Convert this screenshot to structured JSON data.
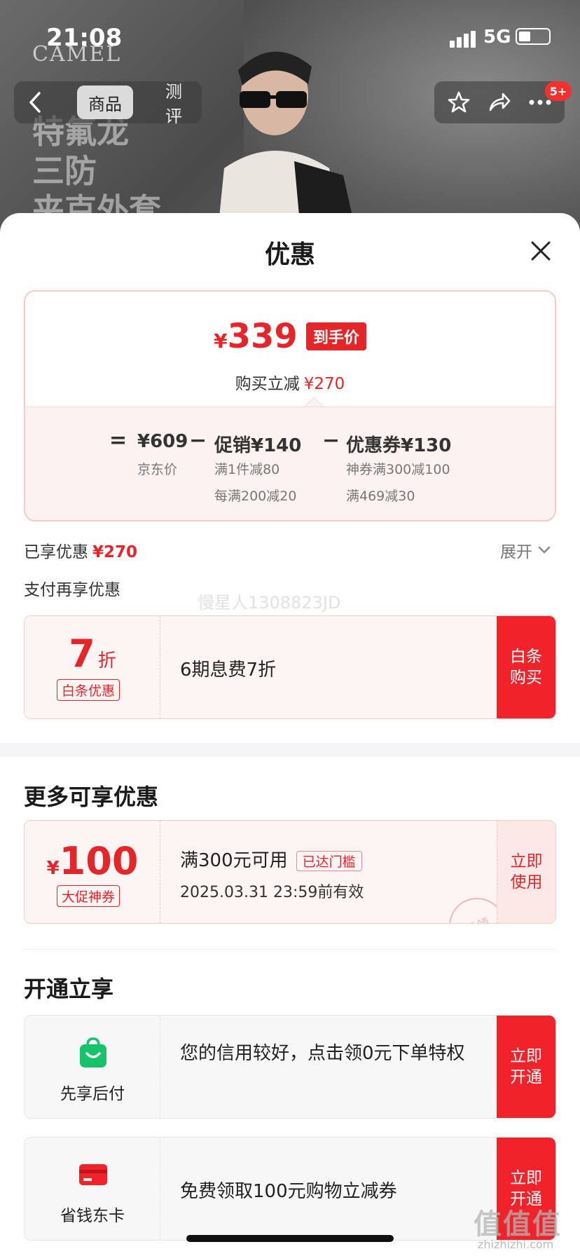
{
  "status_bar": {
    "time": "21:08",
    "network": "5G"
  },
  "hero": {
    "brand": "CAMEL",
    "promo_lines": [
      "特氟龙",
      "三防",
      "夹克外套"
    ]
  },
  "top_nav": {
    "tabs": [
      {
        "label": "商品",
        "active": true
      },
      {
        "label": "测评",
        "active": false
      }
    ],
    "badge": "5+"
  },
  "sheet": {
    "title": "优惠",
    "price_summary": {
      "currency": "¥",
      "final_price": "339",
      "final_tag": "到手价",
      "save_label": "购买立减",
      "save_amount": "¥270",
      "base_price": "¥609",
      "base_label": "京东价",
      "promo_label": "促销¥140",
      "promo_rules": [
        "满1件减80",
        "每满200减20"
      ],
      "coupon_label": "优惠券¥130",
      "coupon_rules": [
        "神券满300减100",
        "满469减30"
      ],
      "op_equal": "=",
      "op_minus": "−"
    },
    "enjoyed": {
      "label": "已享优惠",
      "amount": "¥270",
      "expand": "展开"
    },
    "pay_more_title": "支付再享优惠",
    "watermark": "慢星人1308823JD",
    "baitiao": {
      "discount_num": "7",
      "discount_unit": "折",
      "tag": "白条优惠",
      "desc": "6期息费7折",
      "action": "白条购买"
    },
    "more_title": "更多可享优惠",
    "coupon": {
      "currency": "¥",
      "value": "100",
      "tag": "大促神券",
      "condition": "满300元可用",
      "threshold": "已达门槛",
      "expiry": "2025.03.31 23:59前有效",
      "action": "立即使用",
      "stamp": "已领"
    },
    "open_title": "开通立享",
    "services": [
      {
        "name": "先享后付",
        "desc": "您的信用较好，点击领0元下单特权",
        "action": "立即开通",
        "icon": "shopping-bag-icon",
        "color": "#17c36a"
      },
      {
        "name": "省钱东卡",
        "desc": "免费领取100元购物立减券",
        "action": "立即开通",
        "icon": "card-icon",
        "color": "#f0222a"
      }
    ]
  },
  "site_mark": {
    "logo": "值值值",
    "url": "zhizhizhi.com"
  }
}
